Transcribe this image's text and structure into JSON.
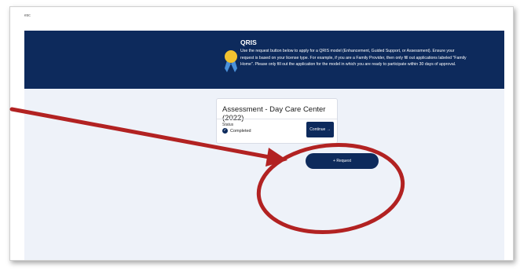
{
  "header": {
    "corner_label": "esc"
  },
  "banner": {
    "title": "QRIS",
    "text": "Use the request button below to apply for a QRIS model (Enhancement, Guided Support, or Assessment). Ensure your request is based on your license type. For example, if you are a Family Provider, then only fill out applications labeled \"Family Home\". Please only fill out the application for the model in which you are ready to participate within 30 days of approval.",
    "ribbon_icon": "award-ribbon-icon"
  },
  "card": {
    "title": "Assessment - Day Care Center (2022)",
    "status_label": "Status",
    "status_value": "Completed",
    "continue_label": "Continue →"
  },
  "actions": {
    "request_label": "+ Request"
  },
  "colors": {
    "navy": "#0d2a5c",
    "content_bg": "#eef2f9",
    "annotation_red": "#b22222",
    "ribbon_gold": "#f2c230",
    "ribbon_blue": "#4a90d9"
  }
}
